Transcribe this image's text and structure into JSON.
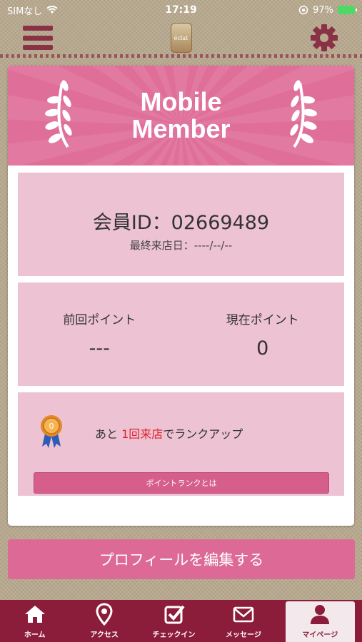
{
  "status_bar": {
    "carrier": "SIMなし",
    "time": "17:19",
    "battery": "97%"
  },
  "header": {
    "logo_text": "éclat",
    "icons": [
      "menu-icon",
      "gear-icon"
    ]
  },
  "banner": {
    "title": "Mobile\nMember"
  },
  "member": {
    "id_text": "会員ID：02669489",
    "last_visit": "最終来店日：----/--/--"
  },
  "points": {
    "previous_label": "前回ポイント",
    "previous_value": "---",
    "current_label": "現在ポイント",
    "current_value": "0"
  },
  "rank": {
    "prefix": "あと",
    "highlight": "1回来店",
    "suffix": "でランクアップ",
    "button_label": "ポイントランクとは"
  },
  "profile_button": "プロフィールを編集する",
  "tabs": [
    {
      "label": "ホーム",
      "icon": "home-icon"
    },
    {
      "label": "アクセス",
      "icon": "location-pin-icon"
    },
    {
      "label": "チェックイン",
      "icon": "checkbox-icon"
    },
    {
      "label": "メッセージ",
      "icon": "mail-icon"
    },
    {
      "label": "マイページ",
      "icon": "person-icon"
    }
  ],
  "colors": {
    "brand": "#8c1d3a",
    "pink": "#df6f99",
    "panel": "#edc2d3",
    "highlight_red": "#e0222e"
  }
}
